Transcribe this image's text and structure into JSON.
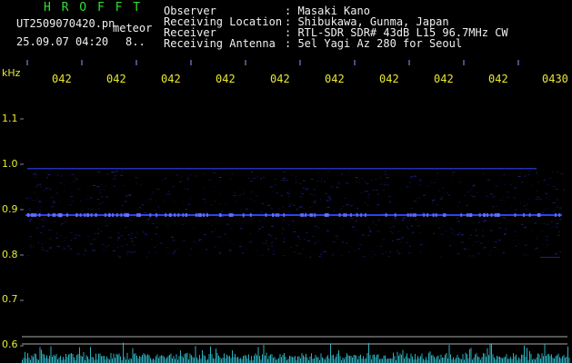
{
  "header": {
    "logo": "H R O F F T",
    "filename": "UT2509070420.pn",
    "meteor_label": "meteor",
    "date_time": "25.09.07 04:20",
    "count": "8..",
    "fields": [
      {
        "label": "Observer",
        "value": ": Masaki Kano"
      },
      {
        "label": "Receiving Location",
        "value": ": Shibukawa, Gunma, Japan"
      },
      {
        "label": "Receiver",
        "value": ": RTL-SDR SDR# 43dB L15 96.7MHz CW"
      },
      {
        "label": "Receiving Antenna",
        "value": ": 5el Yagi Az 280 for Seoul"
      }
    ]
  },
  "time_axis": {
    "ticks": [
      "042",
      "042",
      "042",
      "042",
      "042",
      "042",
      "042",
      "042",
      "042",
      "0430"
    ]
  },
  "freq_axis": {
    "unit": "kHz",
    "ticks": [
      "1.1",
      "1.0",
      "0.9",
      "0.8",
      "0.7",
      "0.6"
    ]
  },
  "colors": {
    "background": "#000000",
    "axis_text": "#e8e832",
    "signal": "#3344ff",
    "activity": "#33ccdd"
  }
}
